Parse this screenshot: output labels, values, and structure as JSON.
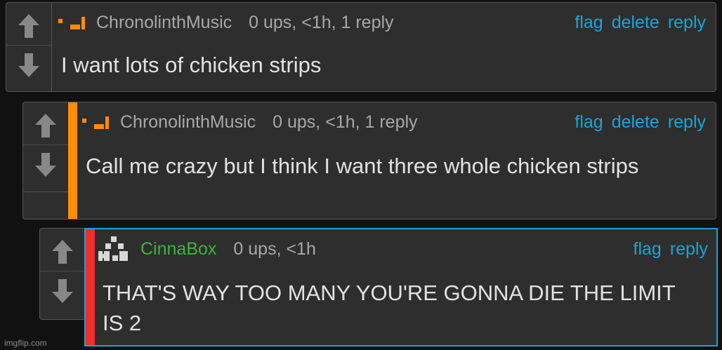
{
  "comments": [
    {
      "username": "ChronolinthMusic",
      "meta": "0 ups, <1h, 1 reply",
      "actions": [
        "flag",
        "delete",
        "reply"
      ],
      "text": "I want lots of chicken strips"
    },
    {
      "username": "ChronolinthMusic",
      "meta": "0 ups, <1h, 1 reply",
      "actions": [
        "flag",
        "delete",
        "reply"
      ],
      "text": "Call me crazy but I think I want three whole chicken strips",
      "bar_color": "#ff8c00"
    },
    {
      "username": "CinnaBox",
      "meta": "0 ups, <1h",
      "actions": [
        "flag",
        "reply"
      ],
      "text": "THAT'S WAY TOO MANY YOU'RE GONNA DIE THE LIMIT IS 2",
      "bar_color": "#ee2d2d",
      "border_color": "#1aa3d9"
    }
  ],
  "icons": {
    "upvote": "upvote-arrow-icon",
    "downvote": "downvote-arrow-icon",
    "avatar": "pixel-avatar-icon"
  },
  "colors": {
    "link": "#1aa3d9",
    "username_green": "#3fb43f",
    "avatar_orange": "#ff8c00"
  },
  "watermark": "imgflip.com"
}
